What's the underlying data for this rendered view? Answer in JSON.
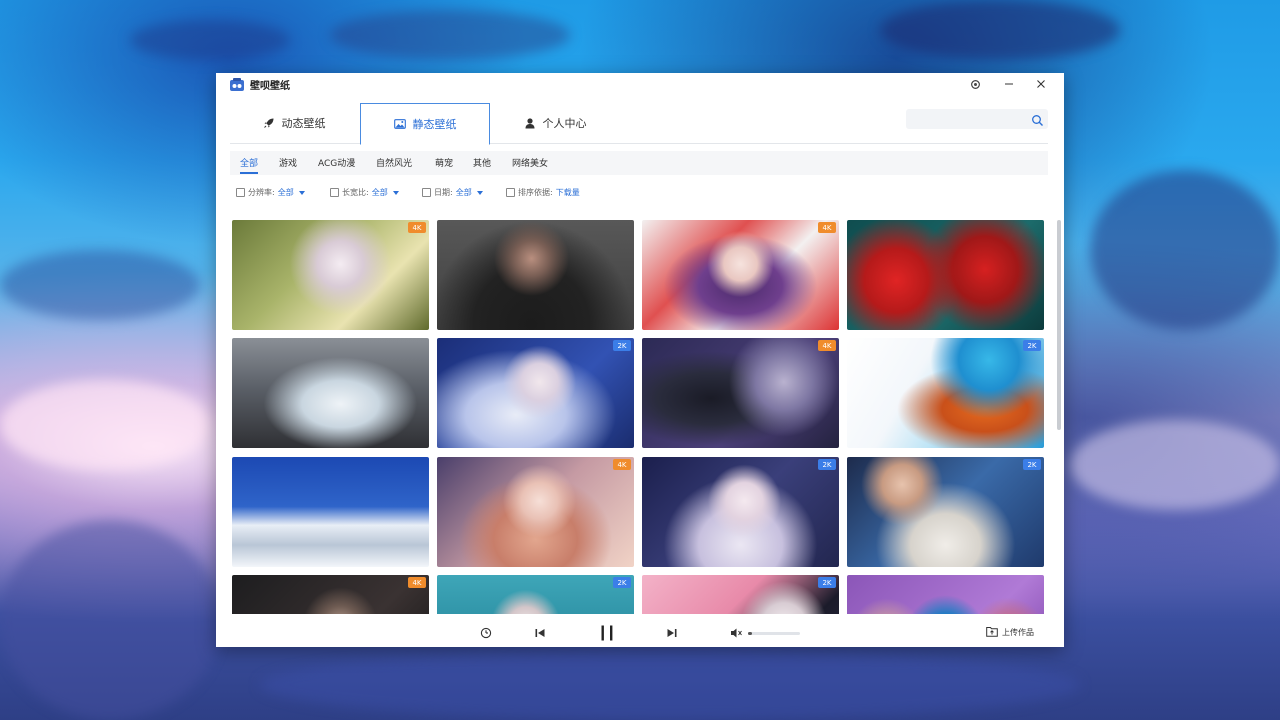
{
  "app": {
    "title": "壁呗壁纸",
    "settings_icon": "gear-icon",
    "minimize_icon": "minimize-icon",
    "close_icon": "close-icon"
  },
  "tabs": [
    {
      "label": "动态壁纸",
      "icon": "rocket-icon",
      "active": false
    },
    {
      "label": "静态壁纸",
      "icon": "image-icon",
      "active": true
    },
    {
      "label": "个人中心",
      "icon": "user-icon",
      "active": false
    }
  ],
  "search": {
    "icon": "search-icon",
    "placeholder": ""
  },
  "categories": [
    {
      "label": "全部",
      "active": true
    },
    {
      "label": "游戏",
      "active": false
    },
    {
      "label": "ACG动漫",
      "active": false
    },
    {
      "label": "自然风光",
      "active": false
    },
    {
      "label": "萌宠",
      "active": false
    },
    {
      "label": "其他",
      "active": false
    },
    {
      "label": "网络美女",
      "active": false
    }
  ],
  "filters": [
    {
      "label": "分辨率:",
      "value": "全部",
      "has_caret": true
    },
    {
      "label": "长宽比:",
      "value": "全部",
      "has_caret": true
    },
    {
      "label": "日期:",
      "value": "全部",
      "has_caret": true
    },
    {
      "label": "排序依据:",
      "value": "下载量",
      "has_caret": false
    }
  ],
  "wallpapers": [
    {
      "theme": "fairy-girl-forest",
      "badge": "4K",
      "badge_color": "orange"
    },
    {
      "theme": "person-in-fur-hat",
      "badge": "",
      "badge_color": ""
    },
    {
      "theme": "anime-girl-red",
      "badge": "4K",
      "badge_color": "orange"
    },
    {
      "theme": "red-flowers-teal",
      "badge": "",
      "badge_color": ""
    },
    {
      "theme": "ice-cave-arch",
      "badge": "",
      "badge_color": ""
    },
    {
      "theme": "white-hair-fairy-blue",
      "badge": "2K",
      "badge_color": "blue"
    },
    {
      "theme": "anime-girl-computer-room",
      "badge": "4K",
      "badge_color": "orange"
    },
    {
      "theme": "goku-blue-hair",
      "badge": "2K",
      "badge_color": "blue"
    },
    {
      "theme": "snow-mountains-blue-sky",
      "badge": "",
      "badge_color": ""
    },
    {
      "theme": "princess-pink",
      "badge": "4K",
      "badge_color": "orange"
    },
    {
      "theme": "fairy-white-flowers",
      "badge": "2K",
      "badge_color": "blue"
    },
    {
      "theme": "girl-sofa-blue",
      "badge": "2K",
      "badge_color": "blue"
    },
    {
      "theme": "dark-scene",
      "badge": "4K",
      "badge_color": "orange"
    },
    {
      "theme": "underwater-girl",
      "badge": "2K",
      "badge_color": "blue"
    },
    {
      "theme": "pink-blossom-girl",
      "badge": "2K",
      "badge_color": "blue"
    },
    {
      "theme": "dragonball-characters-purple",
      "badge": "",
      "badge_color": ""
    }
  ],
  "player": {
    "timer_icon": "timer-icon",
    "prev_icon": "previous-icon",
    "pause_icon": "pause-icon",
    "next_icon": "next-icon",
    "volume_icon": "volume-icon",
    "volume_level": 0.08,
    "upload_label": "上传作品",
    "upload_icon": "upload-folder-icon"
  },
  "colors": {
    "accent": "#2b6fd6",
    "badge_orange": "#f08c2c",
    "badge_blue": "#3b7ee8"
  }
}
